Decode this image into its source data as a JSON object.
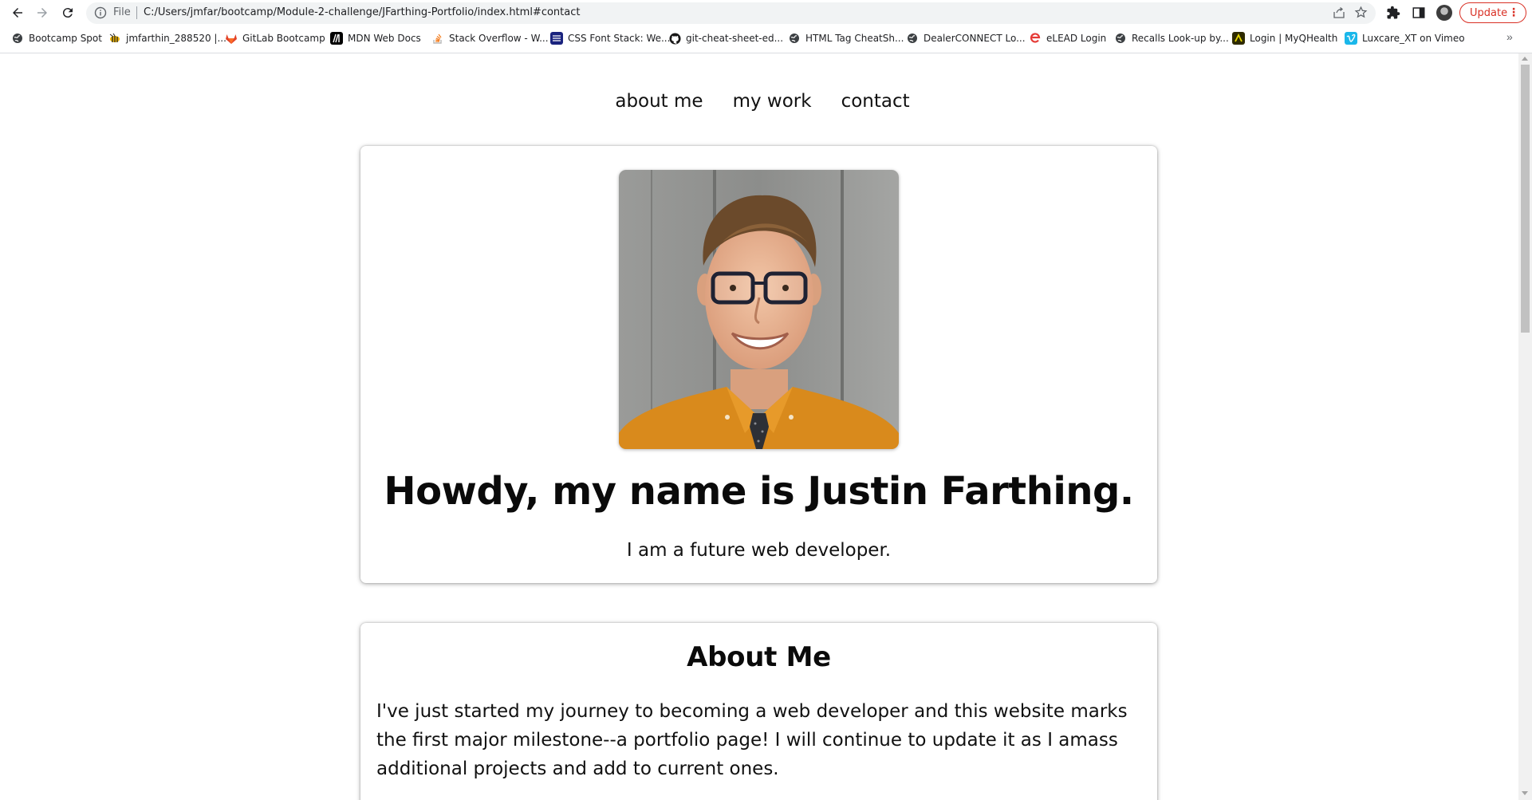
{
  "browser": {
    "address": {
      "scheme_label": "File",
      "url": "C:/Users/jmfar/bootcamp/Module-2-challenge/JFarthing-Portfolio/index.html#contact"
    },
    "update_label": "Update",
    "bookmarks": [
      {
        "label": "Bootcamp Spot",
        "icon": "globe-icon"
      },
      {
        "label": "jmfarthin_288520 |...",
        "icon": "bee-icon"
      },
      {
        "label": "GitLab Bootcamp",
        "icon": "gitlab-icon"
      },
      {
        "label": "MDN Web Docs",
        "icon": "mdn-icon"
      },
      {
        "label": "Stack Overflow - W...",
        "icon": "stackoverflow-icon"
      },
      {
        "label": "CSS Font Stack: We...",
        "icon": "cssfontstack-icon"
      },
      {
        "label": "git-cheat-sheet-ed...",
        "icon": "github-icon"
      },
      {
        "label": "HTML Tag CheatSh...",
        "icon": "globe-icon"
      },
      {
        "label": "DealerCONNECT Lo...",
        "icon": "globe-icon"
      },
      {
        "label": "eLEAD Login",
        "icon": "elead-icon"
      },
      {
        "label": "Recalls Look-up by...",
        "icon": "globe-icon"
      },
      {
        "label": "Login | MyQHealth",
        "icon": "myqhealth-icon"
      },
      {
        "label": "Luxcare_XT on Vimeo",
        "icon": "vimeo-icon"
      }
    ],
    "more_bookmarks": "»"
  },
  "site": {
    "nav": [
      "about me",
      "my work",
      "contact"
    ],
    "hero": {
      "title": "Howdy, my name is Justin Farthing.",
      "subtitle": "I am a future web developer."
    },
    "about": {
      "title": "About Me",
      "text": "I've just started my journey to becoming a web developer and this website marks the first major milestone--a portfolio page! I will continue to update it as I amass additional projects and add to current ones."
    }
  },
  "colors": {
    "update_red": "#d93025",
    "shirt_mustard": "#d98a1c",
    "wall_gray": "#8e8f8d"
  }
}
